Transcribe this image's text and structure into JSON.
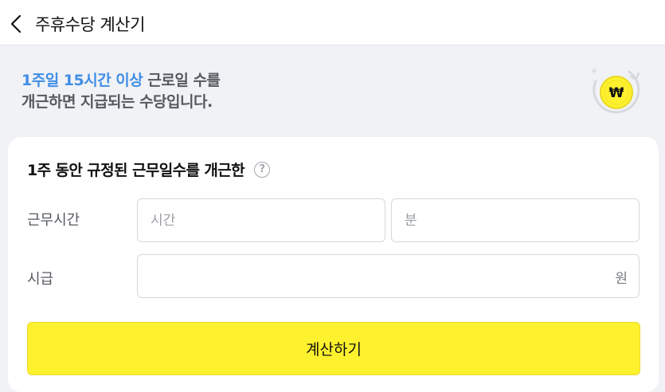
{
  "header": {
    "title": "주휴수당 계산기",
    "back_icon": "chevron-left-icon"
  },
  "banner": {
    "highlight": "1주일 15시간 이상",
    "line1_rest": " 근로일 수를",
    "line2": "개근하면 지급되는 수당입니다.",
    "coin_symbol": "₩",
    "coin_icon": "won-coin-icon",
    "highlight_color": "#3f8ee6",
    "coin_color": "#fef12d"
  },
  "form": {
    "title": "1주 동안 규정된 근무일수를 개근한",
    "help_symbol": "?",
    "work_time": {
      "label": "근무시간",
      "hours_placeholder": "시간",
      "minutes_placeholder": "분"
    },
    "wage": {
      "label": "시급",
      "unit": "원"
    },
    "submit_label": "계산하기",
    "button_color": "#fef12d"
  }
}
